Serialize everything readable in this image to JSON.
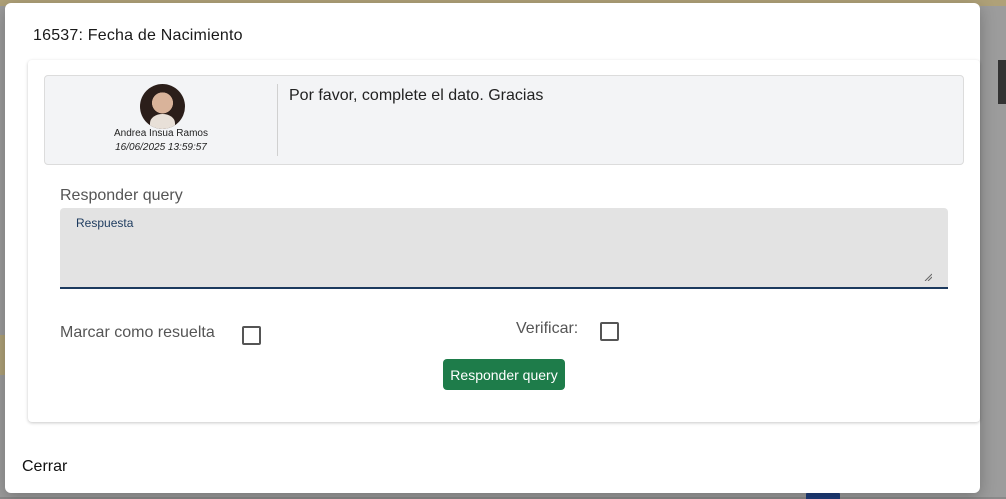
{
  "dialog": {
    "title": "16537: Fecha de Nacimiento",
    "close_label": "Cerrar"
  },
  "message": {
    "author_name": "Andrea Insua Ramos",
    "timestamp": "16/06/2025 13:59:57",
    "text": "Por favor, complete el dato. Gracias"
  },
  "reply": {
    "section_label": "Responder query",
    "field_label": "Respuesta",
    "field_value": "",
    "mark_resolved_label": "Marcar como resuelta",
    "mark_resolved_checked": false,
    "verify_label": "Verificar:",
    "verify_checked": false,
    "submit_label": "Responder query"
  },
  "colors": {
    "primary_button": "#1e7c4a",
    "field_underline": "#1c3a5e"
  }
}
